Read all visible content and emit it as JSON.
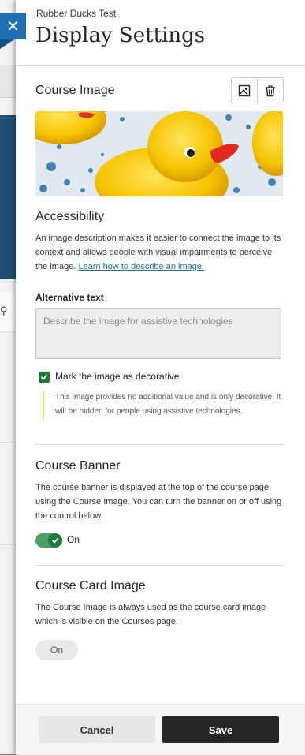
{
  "header": {
    "breadcrumb": "Rubber Ducks Test",
    "title": "Display Settings"
  },
  "course_image": {
    "heading": "Course Image",
    "icons": [
      "image-edit-icon",
      "trash-icon"
    ]
  },
  "accessibility": {
    "heading": "Accessibility",
    "description": "An image description makes it easier to connect the image to its context and allows people with visual impairments to perceive the image.",
    "link": "Learn how to describe an image.",
    "alt_label": "Alternative text",
    "alt_placeholder": "Describe the image for assistive technologies",
    "alt_value": "",
    "decorative_label": "Mark the image as decorative",
    "decorative_checked": true,
    "decorative_note": "This image provides no additional value and is only decorative. It will be hidden for people using assistive technologies."
  },
  "course_banner": {
    "heading": "Course Banner",
    "description": "The course banner is displayed at the top of the course page using the Course Image. You can turn the banner on or off using the control below.",
    "toggle_label": "On",
    "toggle_on": true
  },
  "course_card": {
    "heading": "Course Card Image",
    "description": "The Course Image is always used as the course card image which is visible on the Courses page.",
    "status": "On"
  },
  "footer": {
    "cancel": "Cancel",
    "save": "Save"
  },
  "colors": {
    "accent_blue": "#1e6fb3",
    "success_green": "#1f7a3a",
    "note_yellow": "#f2d64a",
    "save_dark": "#262626"
  }
}
